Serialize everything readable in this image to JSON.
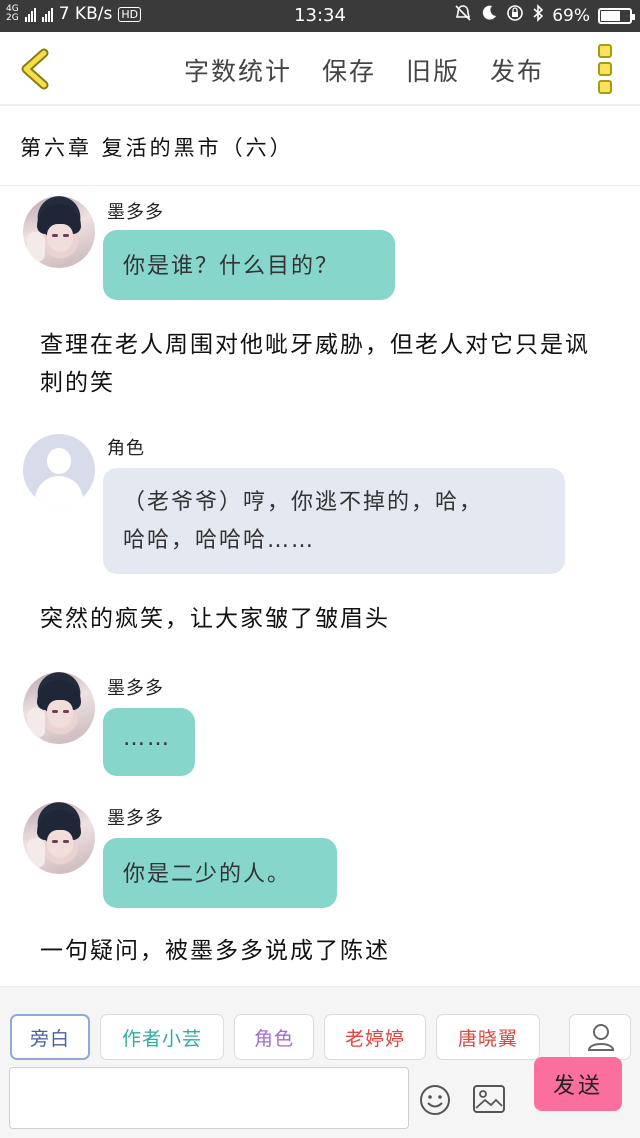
{
  "status_bar": {
    "network_top": "4G",
    "network_bottom": "2G",
    "speed": "7 KB/s",
    "hd": "HD",
    "time": "13:34",
    "battery": "69%",
    "battery_level": 0.69
  },
  "toolbar": {
    "word_count": "字数统计",
    "save": "保存",
    "old_version": "旧版",
    "publish": "发布"
  },
  "chapter": {
    "title": "第六章  复活的黑市（六）"
  },
  "feed": {
    "messages": [
      {
        "type": "chat",
        "speaker": "墨多多",
        "text": "你是谁？什么目的？"
      },
      {
        "type": "narration",
        "text": "查理在老人周围对他呲牙威胁，但老人对它只是讽刺的笑"
      },
      {
        "type": "chat",
        "speaker": "角色",
        "line1": "（老爷爷）哼，你逃不掉的，哈，",
        "line2": "哈哈，哈哈哈……"
      },
      {
        "type": "narration",
        "text": "突然的疯笑，让大家皱了皱眉头"
      },
      {
        "type": "chat",
        "speaker": "墨多多",
        "text": "……"
      },
      {
        "type": "chat",
        "speaker": "墨多多",
        "text": "你是二少的人。"
      },
      {
        "type": "narration",
        "text": "一句疑问，被墨多多说成了陈述"
      }
    ]
  },
  "bottom": {
    "roles": [
      {
        "label": "旁白",
        "color": "#4a5ea0"
      },
      {
        "label": "作者小芸",
        "color": "#2fae9a"
      },
      {
        "label": "角色",
        "color": "#a36ad6"
      },
      {
        "label": "老婷婷",
        "color": "#e0453e"
      },
      {
        "label": "唐晓翼",
        "color": "#e0453e"
      }
    ],
    "input_placeholder": "",
    "send": "发送"
  },
  "colors": {
    "teal_bubble": "#86d6cc",
    "gray_bubble": "#e4e8f0",
    "send_button": "#fa6f9e",
    "menu_square": "#f8e45b"
  }
}
